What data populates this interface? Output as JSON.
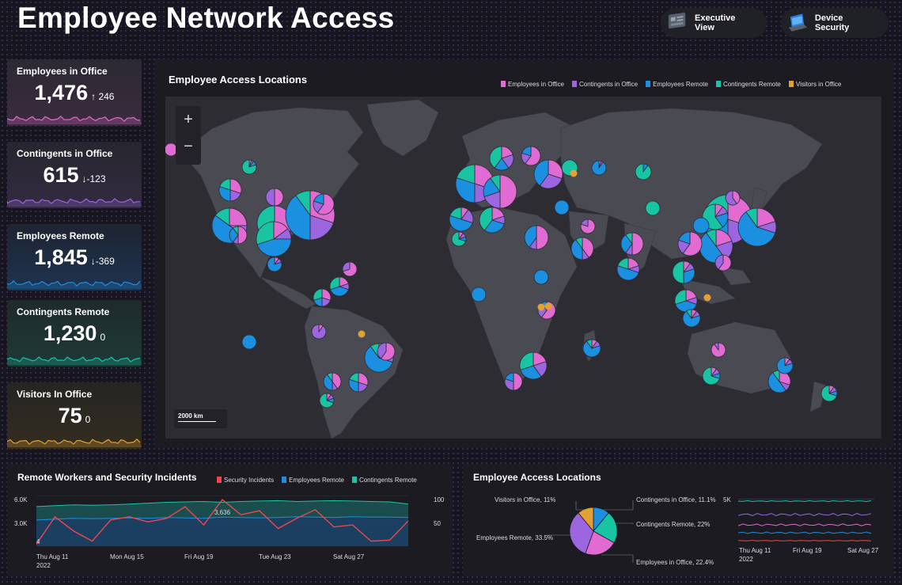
{
  "header": {
    "title": "Employee Network Access",
    "buttons": [
      {
        "label": "Executive View",
        "icon": "dashboard-icon"
      },
      {
        "label": "Device Security",
        "icon": "laptop-icon"
      }
    ]
  },
  "kpis": [
    {
      "label": "Employees in Office",
      "value": "1,476",
      "arrow": "↑",
      "delta": "246",
      "color": "#e26ad3"
    },
    {
      "label": "Contingents in Office",
      "value": "615",
      "arrow": "↓",
      "delta": "-123",
      "color": "#9b66e0"
    },
    {
      "label": "Employees Remote",
      "value": "1,845",
      "arrow": "↓",
      "delta": "-369",
      "color": "#1b8fe0"
    },
    {
      "label": "Contingents Remote",
      "value": "1,230",
      "arrow": "",
      "delta": "0",
      "color": "#19c4a3"
    },
    {
      "label": "Visitors In Office",
      "value": "75",
      "arrow": "",
      "delta": "0",
      "color": "#e3a135"
    }
  ],
  "map_panel": {
    "title": "Employee Access Locations",
    "legend": [
      {
        "label": "Employees in Office",
        "color": "#e26ad3"
      },
      {
        "label": "Contingents in Office",
        "color": "#9b66e0"
      },
      {
        "label": "Employees Remote",
        "color": "#1b8fe0"
      },
      {
        "label": "Contingents Remote",
        "color": "#19c4a3"
      },
      {
        "label": "Visitors in Office",
        "color": "#e3a135"
      }
    ],
    "zoom_in": "+",
    "zoom_out": "−",
    "scale_label": "2000 km"
  },
  "line_panel": {
    "title": "Remote Workers and Security Incidents",
    "legend": [
      {
        "label": "Security Incidents",
        "color": "#f0454d"
      },
      {
        "label": "Employees Remote",
        "color": "#1b8fe0"
      },
      {
        "label": "Contingents Remote",
        "color": "#19c4a3"
      }
    ],
    "y_left": [
      "6.0K",
      "3.0K"
    ],
    "y_right": [
      "100",
      "50"
    ],
    "x_ticks": [
      "Thu Aug 11",
      "Mon Aug 15",
      "Fri Aug 19",
      "Tue Aug 23",
      "Sat Aug 27"
    ],
    "year": "2022",
    "annotation": "3,636",
    "min_label": "4"
  },
  "pie_panel": {
    "title": "Employee Access Locations",
    "slices": [
      {
        "label": "Contingents in Office, 11.1%",
        "value": 11.1,
        "color": "#1b8fe0"
      },
      {
        "label": "Contingents Remote, 22%",
        "value": 22,
        "color": "#19c4a3"
      },
      {
        "label": "Employees in Office, 22.4%",
        "value": 22.4,
        "color": "#e26ad3"
      },
      {
        "label": "Employees Remote, 33.5%",
        "value": 33.5,
        "color": "#9b66e0"
      },
      {
        "label": "Visitors in Office, 11%",
        "value": 11,
        "color": "#e3a135"
      }
    ],
    "mini_y": "5K",
    "mini_x": [
      "Thu Aug 11",
      "Fri Aug 19",
      "Sat Aug 27"
    ],
    "mini_year": "2022"
  },
  "chart_data": [
    {
      "type": "line",
      "title": "Remote Workers and Security Incidents",
      "x": [
        "Aug 11",
        "Aug 12",
        "Aug 13",
        "Aug 14",
        "Aug 15",
        "Aug 16",
        "Aug 17",
        "Aug 18",
        "Aug 19",
        "Aug 20",
        "Aug 21",
        "Aug 22",
        "Aug 23",
        "Aug 24",
        "Aug 25",
        "Aug 26",
        "Aug 27",
        "Aug 28",
        "Aug 29",
        "Aug 30",
        "Aug 31"
      ],
      "series": [
        {
          "name": "Security Incidents",
          "axis": "right",
          "values": [
            4,
            58,
            30,
            10,
            52,
            58,
            48,
            55,
            78,
            42,
            92,
            62,
            70,
            35,
            55,
            72,
            38,
            42,
            10,
            12,
            50
          ]
        },
        {
          "name": "Employees Remote",
          "axis": "left",
          "values": [
            3100,
            3200,
            3300,
            3250,
            3300,
            3350,
            3300,
            3400,
            3350,
            3300,
            3450,
            3400,
            3350,
            3400,
            3500,
            3450,
            3400,
            3500,
            3450,
            3450,
            3400
          ]
        },
        {
          "name": "Contingents Remote",
          "axis": "left",
          "values": [
            4700,
            4800,
            4900,
            4850,
            4900,
            5000,
            5100,
            5200,
            5250,
            5300,
            5200,
            5300,
            5350,
            5400,
            5300,
            5350,
            5400,
            5350,
            5300,
            5250,
            5000
          ]
        }
      ],
      "ylim_left": [
        0,
        6000
      ],
      "ylim_right": [
        0,
        100
      ]
    },
    {
      "type": "pie",
      "title": "Employee Access Locations",
      "labels": [
        "Contingents in Office",
        "Contingents Remote",
        "Employees in Office",
        "Employees Remote",
        "Visitors in Office"
      ],
      "values": [
        11.1,
        22,
        22.4,
        33.5,
        11
      ]
    }
  ]
}
